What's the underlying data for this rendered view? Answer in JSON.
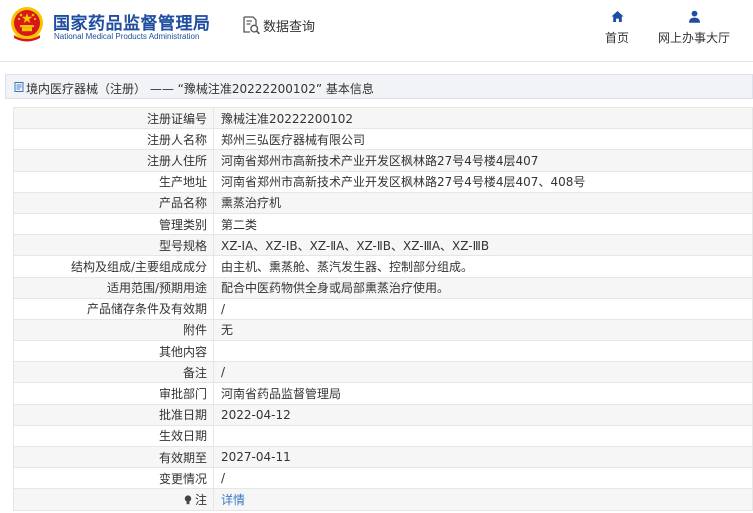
{
  "header": {
    "title_cn": "国家药品监督管理局",
    "title_en": "National Medical Products Administration",
    "search_label": "数据查询",
    "nav": [
      {
        "label": "首页",
        "icon": "home-icon"
      },
      {
        "label": "网上办事大厅",
        "icon": "user-icon"
      }
    ]
  },
  "colors": {
    "brand": "#1f4ea0",
    "link": "#3a78c5",
    "emblem_red": "#d8161b",
    "emblem_gold": "#f5c400"
  },
  "page_title": "境内医疗器械（注册） —— “豫械注准20222200102” 基本信息",
  "rows": [
    {
      "key": "注册证编号",
      "value": "豫械注准20222200102"
    },
    {
      "key": "注册人名称",
      "value": "郑州三弘医疗器械有限公司"
    },
    {
      "key": "注册人住所",
      "value": "河南省郑州市高新技术产业开发区枫林路27号4号楼4层407"
    },
    {
      "key": "生产地址",
      "value": "河南省郑州市高新技术产业开发区枫林路27号4号楼4层407、408号"
    },
    {
      "key": "产品名称",
      "value": "熏蒸治疗机"
    },
    {
      "key": "管理类别",
      "value": "第二类"
    },
    {
      "key": "型号规格",
      "value": "XZ-ⅠA、XZ-ⅠB、XZ-ⅡA、XZ-ⅡB、XZ-ⅢA、XZ-ⅢB"
    },
    {
      "key": "结构及组成/主要组成成分",
      "value": "由主机、熏蒸舱、蒸汽发生器、控制部分组成。"
    },
    {
      "key": "适用范围/预期用途",
      "value": "配合中医药物供全身或局部熏蒸治疗使用。"
    },
    {
      "key": "产品储存条件及有效期",
      "value": "/"
    },
    {
      "key": "附件",
      "value": "无"
    },
    {
      "key": "其他内容",
      "value": ""
    },
    {
      "key": "备注",
      "value": "/"
    },
    {
      "key": "审批部门",
      "value": "河南省药品监督管理局"
    },
    {
      "key": "批准日期",
      "value": "2022-04-12"
    },
    {
      "key": "生效日期",
      "value": ""
    },
    {
      "key": "有效期至",
      "value": "2027-04-11"
    },
    {
      "key": "变更情况",
      "value": "/"
    }
  ],
  "note_row": {
    "key": "注",
    "link_label": "详情",
    "icon": "lightbulb-icon"
  }
}
